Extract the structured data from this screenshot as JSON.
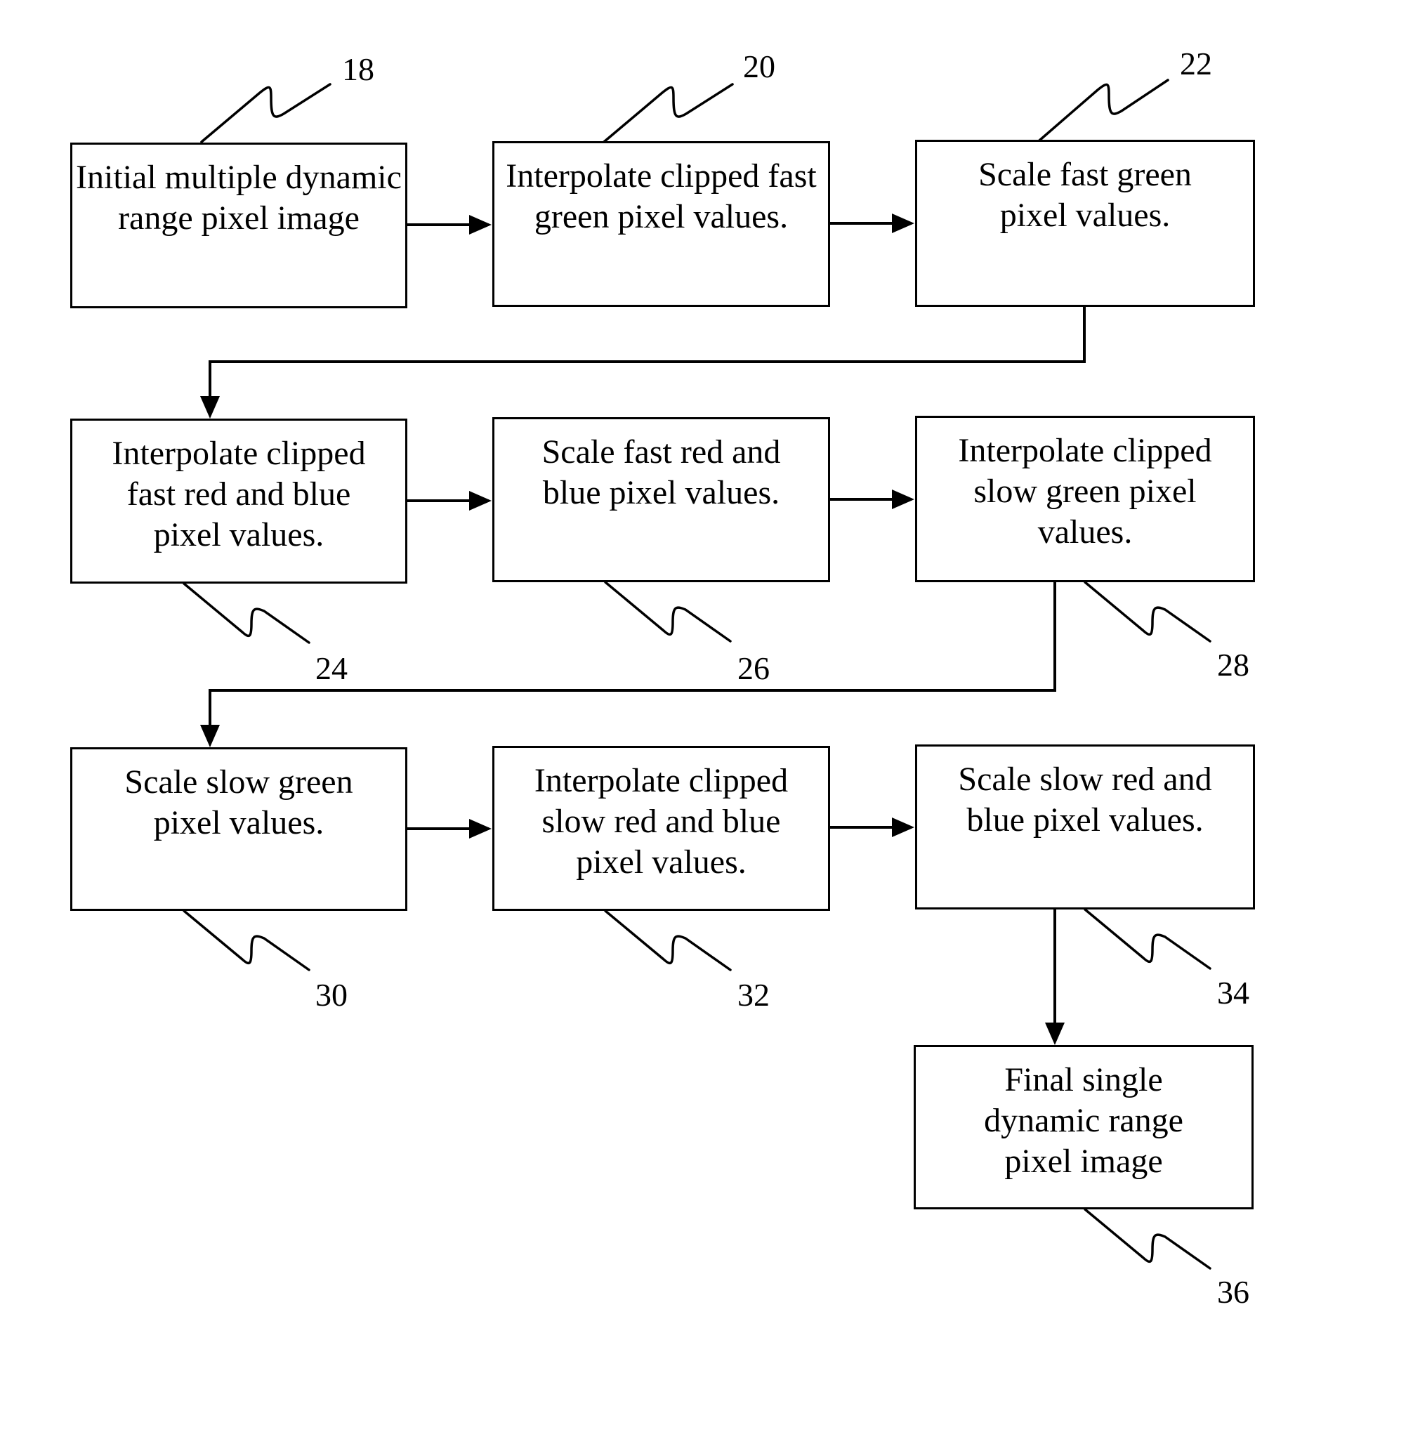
{
  "diagram": {
    "type": "flowchart",
    "steps": [
      {
        "ref": "18",
        "label": "Initial multiple dynamic range pixel image"
      },
      {
        "ref": "20",
        "label": "Interpolate clipped fast green pixel values."
      },
      {
        "ref": "22",
        "label": "Scale fast green pixel values."
      },
      {
        "ref": "24",
        "label": "Interpolate clipped fast red and blue pixel values."
      },
      {
        "ref": "26",
        "label": "Scale fast red and blue pixel values."
      },
      {
        "ref": "28",
        "label": "Interpolate clipped slow green pixel values."
      },
      {
        "ref": "30",
        "label": "Scale slow green pixel values."
      },
      {
        "ref": "32",
        "label": "Interpolate clipped slow red and blue pixel values."
      },
      {
        "ref": "34",
        "label": "Scale slow red and blue pixel values."
      },
      {
        "ref": "36",
        "label": "Final single dynamic range pixel image"
      }
    ],
    "edges": [
      {
        "from": "18",
        "to": "20"
      },
      {
        "from": "20",
        "to": "22"
      },
      {
        "from": "22",
        "to": "24"
      },
      {
        "from": "24",
        "to": "26"
      },
      {
        "from": "26",
        "to": "28"
      },
      {
        "from": "28",
        "to": "30"
      },
      {
        "from": "30",
        "to": "32"
      },
      {
        "from": "32",
        "to": "34"
      },
      {
        "from": "34",
        "to": "36"
      }
    ]
  }
}
